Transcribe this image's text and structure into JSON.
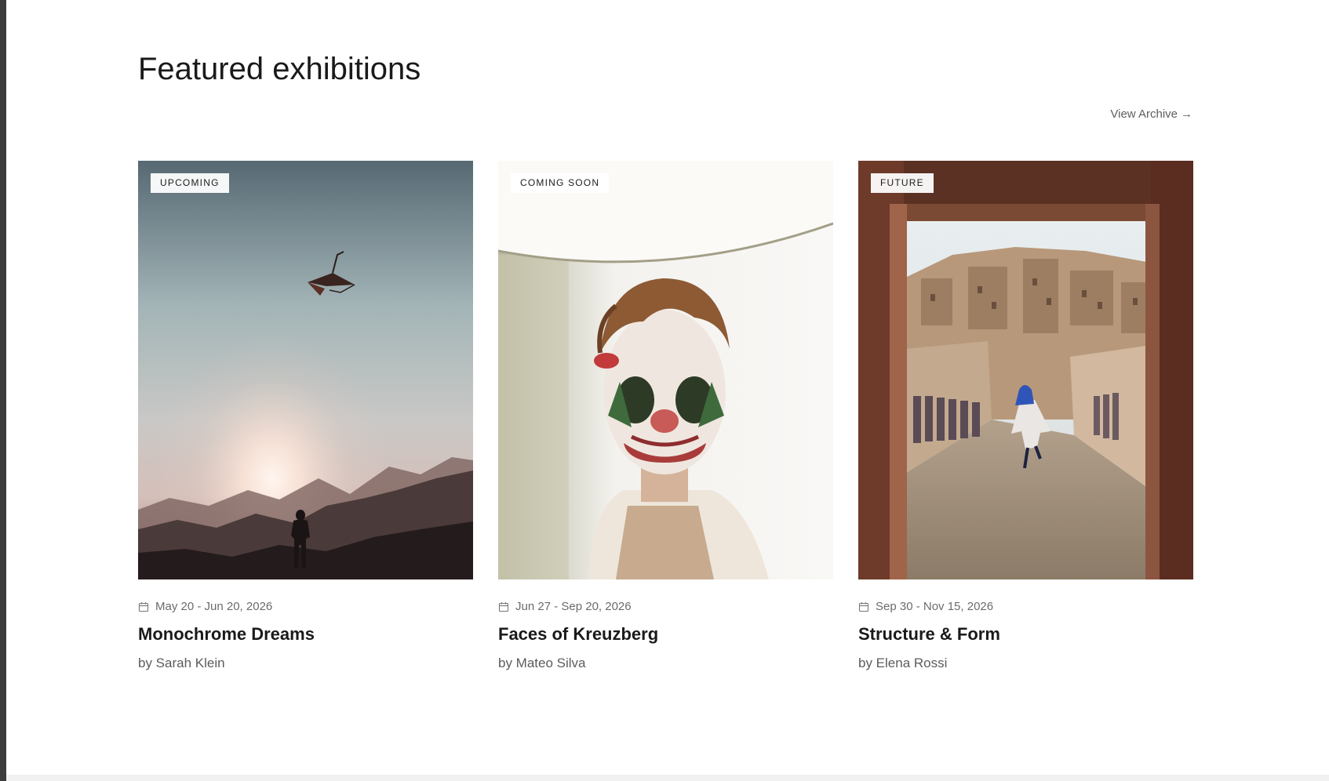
{
  "section": {
    "title": "Featured exhibitions",
    "archive_link": "View Archive",
    "archive_arrow": "→"
  },
  "exhibitions": [
    {
      "badge": "UPCOMING",
      "dates": "May 20 - Jun 20, 2026",
      "title": "Monochrome Dreams",
      "artist": "by Sarah Klein",
      "image": "silhouette-flying-kite-at-sunset"
    },
    {
      "badge": "COMING SOON",
      "dates": "Jun 27 - Sep 20, 2026",
      "title": "Faces of Kreuzberg",
      "artist": "by Mateo Silva",
      "image": "portrait-clown-face-paint"
    },
    {
      "badge": "FUTURE",
      "dates": "Sep 30 - Nov 15, 2026",
      "title": "Structure & Form",
      "artist": "by Elena Rossi",
      "image": "desert-kasbah-alley-jumping-figure"
    }
  ],
  "colors": {
    "frame": "#3c3c3c",
    "page_background": "#ffffff",
    "title_text": "#1a1a1a",
    "muted_text": "#6b6b6b"
  },
  "icons": {
    "date": "calendar-icon",
    "archive": "arrow-right-icon"
  }
}
